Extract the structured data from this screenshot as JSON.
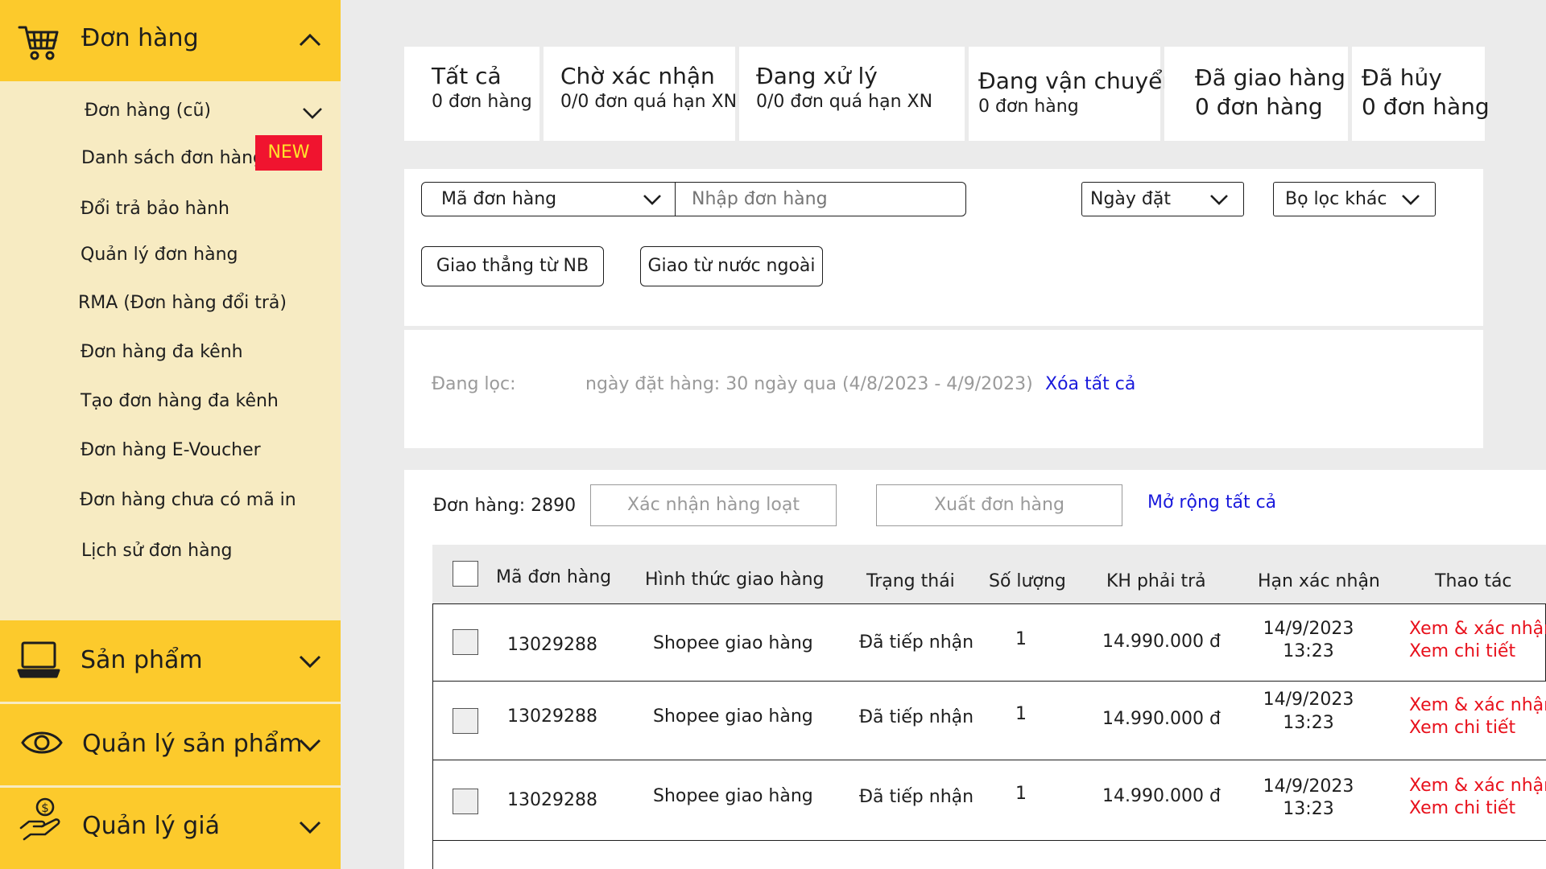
{
  "sidebar": {
    "orders_section": {
      "label": "Đơn hàng",
      "icon": "cart-icon"
    },
    "sub_items": [
      {
        "label": "Đơn hàng (cũ)"
      },
      {
        "label": "Danh sách đơn hàng"
      },
      {
        "label": "Đổi trả bảo hành"
      },
      {
        "label": "Quản lý đơn hàng"
      },
      {
        "label": "RMA (Đơn hàng đổi trả)"
      },
      {
        "label": "Đơn hàng đa kênh"
      },
      {
        "label": "Tạo đơn hàng đa kênh"
      },
      {
        "label": "Đơn hàng E-Voucher"
      },
      {
        "label": "Đơn hàng chưa có mã in"
      },
      {
        "label": "Lịch sử đơn hàng"
      }
    ],
    "new_badge": "NEW",
    "products_section": {
      "label": "Sản phẩm",
      "icon": "laptop-icon"
    },
    "manage_products_section": {
      "label": "Quản lý sản phẩm",
      "icon": "eye-icon"
    },
    "pricing_section": {
      "label": "Quản lý giá",
      "icon": "hand-coin-icon"
    }
  },
  "tabs": [
    {
      "title": "Tất cả",
      "sub": "0 đơn hàng"
    },
    {
      "title": "Chờ xác nhận",
      "sub": "0/0 đơn quá hạn XN"
    },
    {
      "title": "Đang xử lý",
      "sub": "0/0 đơn quá hạn XN"
    },
    {
      "title": "Đang vận chuyển",
      "sub": "0 đơn hàng"
    },
    {
      "title": "Đã giao hàng",
      "sub": "0 đơn hàng"
    },
    {
      "title": "Đã hủy",
      "sub": "0 đơn hàng"
    }
  ],
  "filters": {
    "search_type": "Mã đơn hàng",
    "search_placeholder": "Nhập đơn hàng",
    "date_filter": "Ngày đặt",
    "other_filter": "Bọ lọc khác",
    "chip_domestic": "Giao thẳng từ NB",
    "chip_foreign": "Giao từ nước ngoài"
  },
  "active_filter": {
    "label": "Đang lọc:",
    "value": "ngày đặt hàng: 30 ngày qua (4/8/2023 - 4/9/2023)",
    "clear_all": "Xóa tất cả"
  },
  "toolbar": {
    "order_count": "Đơn hàng: 2890",
    "bulk_confirm": "Xác nhận hàng loạt",
    "export": "Xuất đơn hàng",
    "expand_all": "Mở rộng tất cả"
  },
  "table": {
    "headers": {
      "order_id": "Mã đơn hàng",
      "shipping": "Hình thức giao hàng",
      "status": "Trạng thái",
      "quantity": "Số lượng",
      "amount": "KH phải trả",
      "deadline": "Hạn xác nhận",
      "actions": "Thao tác"
    },
    "rows": [
      {
        "order_id": "13029288",
        "shipping": "Shopee giao hàng",
        "status": "Đã tiếp nhận",
        "quantity": "1",
        "amount": "14.990.000 đ",
        "deadline_date": "14/9/2023",
        "deadline_time": "13:23",
        "action_confirm": "Xem & xác nhận",
        "action_detail": "Xem chi tiết"
      },
      {
        "order_id": "13029288",
        "shipping": "Shopee giao hàng",
        "status": "Đã tiếp nhận",
        "quantity": "1",
        "amount": "14.990.000 đ",
        "deadline_date": "14/9/2023",
        "deadline_time": "13:23",
        "action_confirm": "Xem & xác nhận",
        "action_detail": "Xem chi tiết"
      },
      {
        "order_id": "13029288",
        "shipping": "Shopee giao hàng",
        "status": "Đã tiếp nhận",
        "quantity": "1",
        "amount": "14.990.000 đ",
        "deadline_date": "14/9/2023",
        "deadline_time": "13:23",
        "action_confirm": "Xem & xác nhận",
        "action_detail": "Xem chi tiết"
      }
    ]
  },
  "colors": {
    "sidebar_bg": "#f7ebc2",
    "section_header": "#fcca2c",
    "new_badge_bg": "#f0142f",
    "new_badge_text": "#ffe32b",
    "link_blue": "#1a1adc",
    "action_red": "#e8111c"
  }
}
